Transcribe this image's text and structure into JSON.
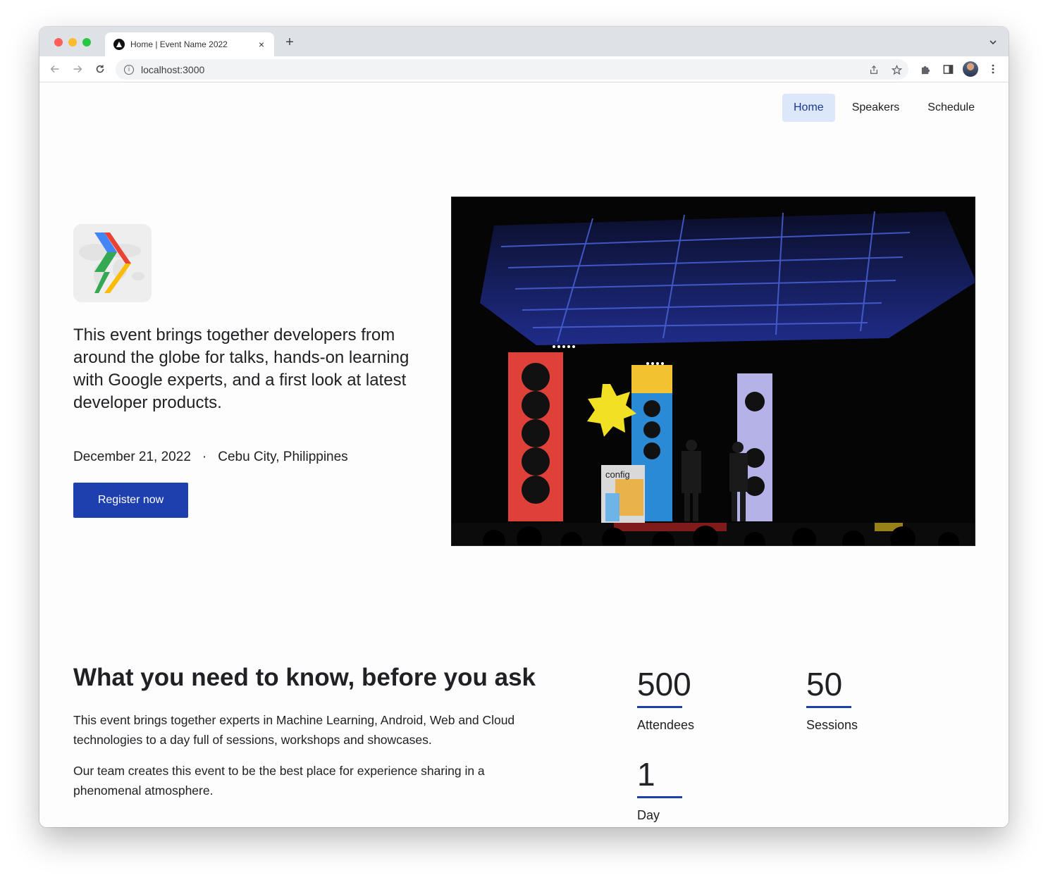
{
  "browser": {
    "tab_title": "Home | Event Name 2022",
    "tab_close": "×",
    "new_tab": "+",
    "url": "localhost:3000",
    "info_icon": "i"
  },
  "nav": {
    "items": [
      {
        "label": "Home",
        "active": true
      },
      {
        "label": "Speakers",
        "active": false
      },
      {
        "label": "Schedule",
        "active": false
      }
    ]
  },
  "hero": {
    "description": "This event brings together developers from around the globe for talks, hands-on learning with Google experts, and a first look at latest developer products.",
    "date": "December 21, 2022",
    "separator": "·",
    "location": "Cebu City, Philippines",
    "register_label": "Register now",
    "stage_sign": "config"
  },
  "about": {
    "title": "What you need to know, before you ask",
    "paragraph1": "This event brings together experts in Machine Learning, Android, Web and Cloud technologies to a day full of sessions, workshops and showcases.",
    "paragraph2": "Our team creates this event to be the best place for experience sharing in a phenomenal atmosphere."
  },
  "stats": [
    {
      "value": "500",
      "label": "Attendees"
    },
    {
      "value": "50",
      "label": "Sessions"
    },
    {
      "value": "1",
      "label": "Day"
    }
  ],
  "colors": {
    "primary": "#1e40af",
    "nav_active_bg": "#dde7fa"
  }
}
